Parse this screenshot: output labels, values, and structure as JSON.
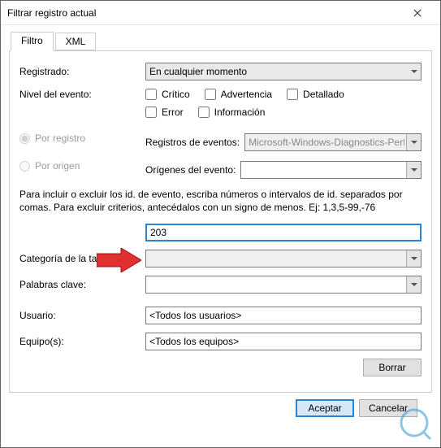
{
  "window": {
    "title": "Filtrar registro actual"
  },
  "tabs": {
    "filter": "Filtro",
    "xml": "XML"
  },
  "form": {
    "registrado_label": "Registrado:",
    "registrado_value": "En cualquier momento",
    "nivel_label": "Nivel del evento:",
    "chk_critico": "Crítico",
    "chk_advertencia": "Advertencia",
    "chk_detallado": "Detallado",
    "chk_error": "Error",
    "chk_informacion": "Información",
    "radio_por_registro": "Por registro",
    "radio_por_origen": "Por origen",
    "registros_label": "Registros de eventos:",
    "registros_value": "Microsoft-Windows-Diagnostics-Perform",
    "origenes_label": "Orígenes del evento:",
    "origenes_value": "",
    "help_text": "Para incluir o excluir los id. de evento, escriba números o intervalos de id. separados por comas. Para excluir criterios, antecédalos con un signo de menos. Ej: 1,3,5-99,-76",
    "event_id_value": "203",
    "categoria_label": "Categoría de la tarea:",
    "categoria_value": "",
    "palabras_label": "Palabras clave:",
    "palabras_value": "",
    "usuario_label": "Usuario:",
    "usuario_value": "<Todos los usuarios>",
    "equipos_label": "Equipo(s):",
    "equipos_value": "<Todos los equipos>",
    "borrar": "Borrar"
  },
  "footer": {
    "aceptar": "Aceptar",
    "cancelar": "Cancelar"
  }
}
